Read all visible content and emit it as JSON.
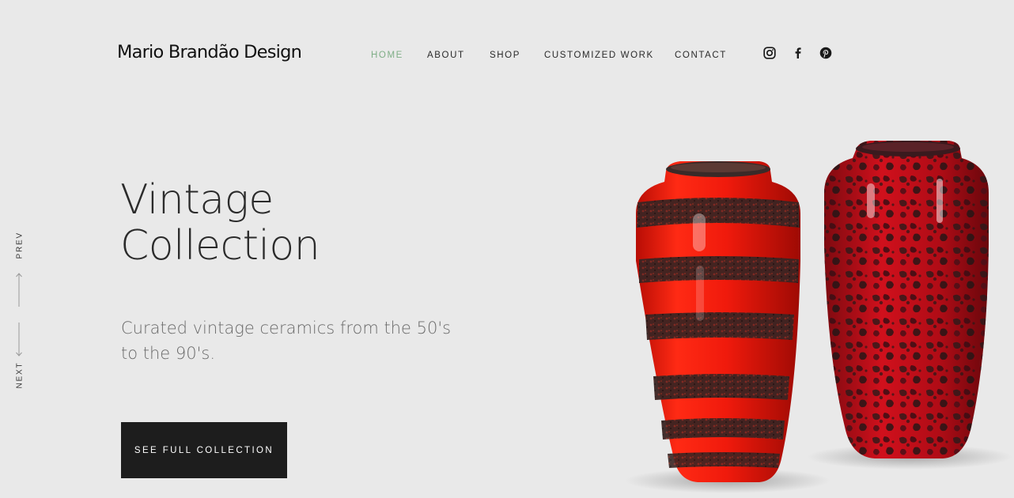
{
  "brand": {
    "name": "Mario Brandão Design"
  },
  "nav": {
    "items": [
      {
        "label": "HOME",
        "active": true
      },
      {
        "label": "ABOUT",
        "active": false
      },
      {
        "label": "SHOP",
        "active": false
      },
      {
        "label": "CUSTOMIZED WORK",
        "active": false
      },
      {
        "label": "CONTACT",
        "active": false
      }
    ],
    "active_color": "#7fae86"
  },
  "social": [
    {
      "icon": "instagram-icon"
    },
    {
      "icon": "facebook-icon"
    },
    {
      "icon": "pinterest-icon"
    }
  ],
  "slider_nav": {
    "prev_label": "PREV",
    "next_label": "NEXT"
  },
  "hero": {
    "title_line1": "Vintage",
    "title_line2": "Collection",
    "subtitle_line1": "Curated vintage ceramics from the 50's",
    "subtitle_line2": "to the 90's.",
    "cta_label": "SEE FULL COLLECTION"
  },
  "colors": {
    "background": "#e9e9e9",
    "cta_bg": "#1d1d1d",
    "vase_red": "#e8180f"
  }
}
